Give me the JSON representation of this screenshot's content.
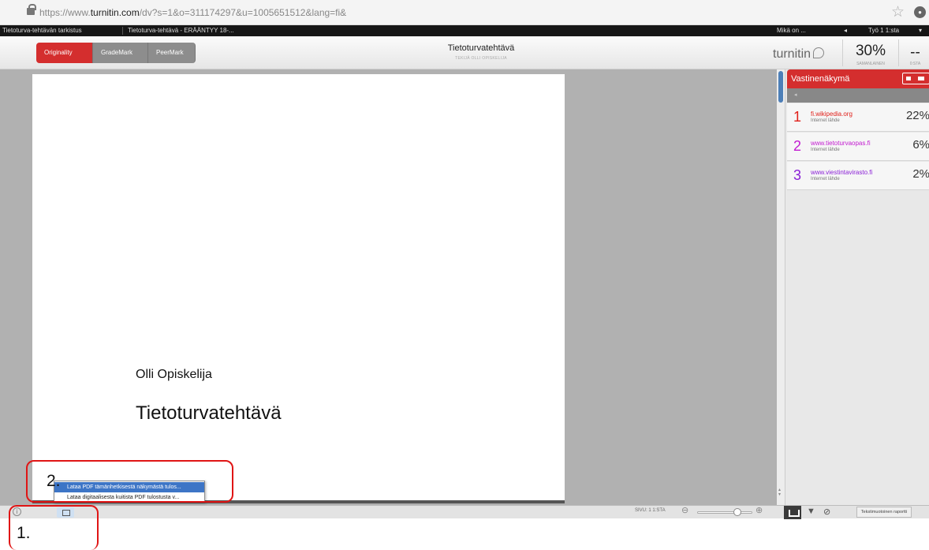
{
  "browser": {
    "url_prefix": "https://www.",
    "url_domain": "turnitin.com",
    "url_rest": "/dv?s=1&o=311174297&u=1005651512&lang=fi&"
  },
  "tabbar": {
    "tab1": "Tietoturva-tehtävän tarkistus",
    "tab2": "Tietoturva-tehtävä - ERÄÄNTYY 18-...",
    "help": "Mikä on ...",
    "prev": "◂",
    "work": "Työ 1 1:sta",
    "dropdown": "▾"
  },
  "toolbar": {
    "originality": "Originality",
    "grademark": "GradeMark",
    "peermark": "PeerMark",
    "doc_title": "Tietoturvatehtävä",
    "doc_author": "TEKIJÄ OLLI OPISKELIJA",
    "logo": "turnitin",
    "score": "30%",
    "score_label": "SAMANLAINEN",
    "dash": "--",
    "dash_label": "0:STA"
  },
  "document": {
    "author": "Olli Opiskelija",
    "title": "Tietoturvatehtävä"
  },
  "side_panel": {
    "header": "Vastinenäkymä",
    "nav": "◂",
    "matches": [
      {
        "num": "1",
        "source": "fi.wikipedia.org",
        "type": "Internet lähde",
        "pct": "22%",
        "color": "#e0201a"
      },
      {
        "num": "2",
        "source": "www.tietoturvaopas.fi",
        "type": "Internet lähde",
        "pct": "6%",
        "color": "#c21ad0"
      },
      {
        "num": "3",
        "source": "www.viestintavirasto.fi",
        "type": "Internet lähde",
        "pct": "2%",
        "color": "#8a1fd6"
      }
    ]
  },
  "bottombar": {
    "info": "i",
    "page_indicator": "SIVU: 1 1:STA",
    "zoom_out": "⊖",
    "zoom_in": "⊕",
    "filter": "▼",
    "block": "⊘",
    "report": "Tekstimuotoinen raportti"
  },
  "print_menu": {
    "item1": "Lataa PDF tämänhetkisestä näkymästä tulos...",
    "item2": "Lataa digitaalisesta kuitista PDF tulostusta v..."
  },
  "annotations": {
    "label1": "1.",
    "label2": "2."
  }
}
